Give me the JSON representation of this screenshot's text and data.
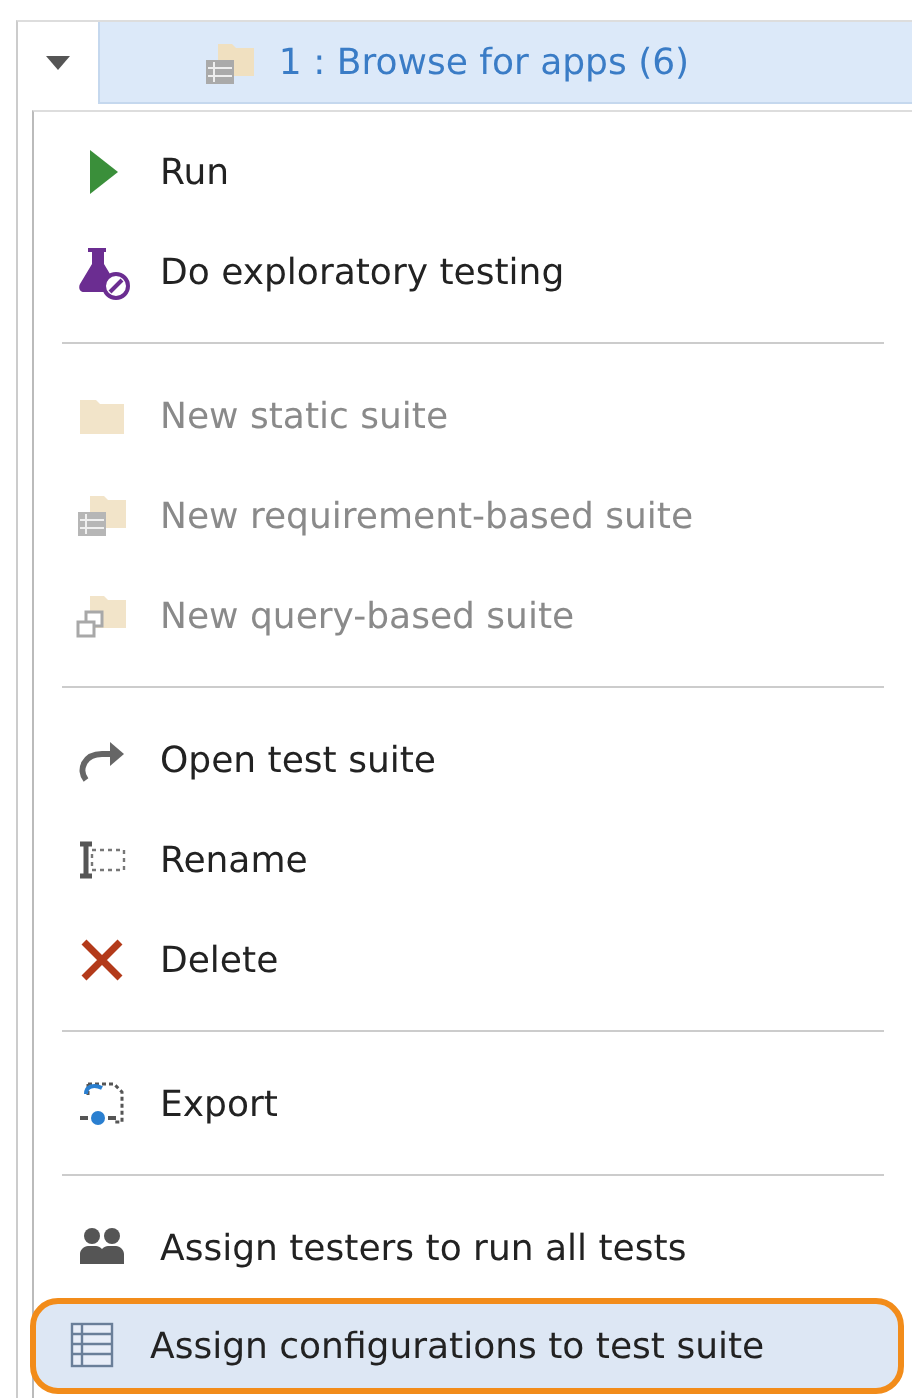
{
  "header": {
    "title": "1 : Browse for apps (6)"
  },
  "menu": {
    "sections": [
      {
        "items": [
          {
            "label": "Run",
            "kind": "play",
            "disabled": false,
            "selected": false
          },
          {
            "label": "Do exploratory testing",
            "kind": "flask",
            "disabled": false,
            "selected": false
          }
        ]
      },
      {
        "items": [
          {
            "label": "New static suite",
            "kind": "folder",
            "disabled": true,
            "selected": false
          },
          {
            "label": "New requirement-based suite",
            "kind": "requirement",
            "disabled": true,
            "selected": false
          },
          {
            "label": "New query-based suite",
            "kind": "query",
            "disabled": true,
            "selected": false
          }
        ]
      },
      {
        "items": [
          {
            "label": "Open test suite",
            "kind": "open",
            "disabled": false,
            "selected": false
          },
          {
            "label": "Rename",
            "kind": "rename",
            "disabled": false,
            "selected": false
          },
          {
            "label": "Delete",
            "kind": "delete",
            "disabled": false,
            "selected": false
          }
        ]
      },
      {
        "items": [
          {
            "label": "Export",
            "kind": "export",
            "disabled": false,
            "selected": false
          }
        ]
      },
      {
        "items": [
          {
            "label": "Assign testers to run all tests",
            "kind": "testers",
            "disabled": false,
            "selected": false
          },
          {
            "label": "Assign configurations to test suite",
            "kind": "configurations",
            "disabled": false,
            "selected": true
          }
        ]
      }
    ]
  }
}
